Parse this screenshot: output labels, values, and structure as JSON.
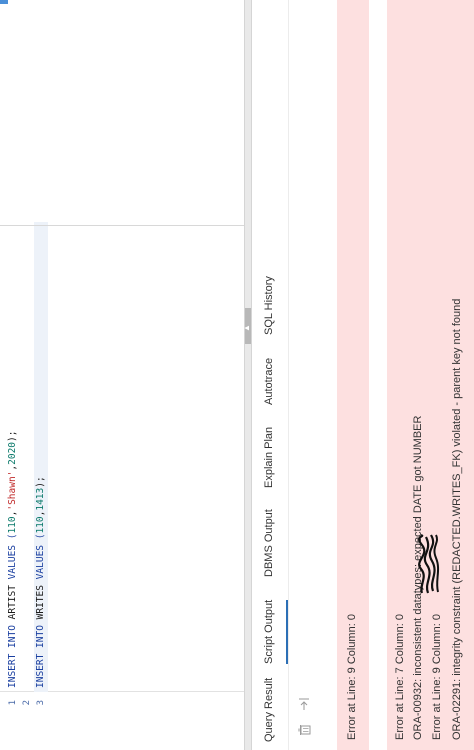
{
  "editor": {
    "lines": [
      {
        "number": "1",
        "tokens": [
          {
            "t": "INSERT INTO ",
            "c": "kw"
          },
          {
            "t": "ARTIST ",
            "c": ""
          },
          {
            "t": "VALUES (",
            "c": "kw"
          },
          {
            "t": "110",
            "c": "num"
          },
          {
            "t": ",",
            "c": ""
          },
          {
            "t": "'Shawn'",
            "c": "str"
          },
          {
            "t": ",",
            "c": ""
          },
          {
            "t": "2020",
            "c": "num"
          },
          {
            "t": ");",
            "c": ""
          }
        ]
      },
      {
        "number": "2",
        "tokens": []
      },
      {
        "number": "3",
        "tokens": [
          {
            "t": "INSERT INTO ",
            "c": "kw"
          },
          {
            "t": "WRITES ",
            "c": ""
          },
          {
            "t": "VALUES (",
            "c": "kw"
          },
          {
            "t": "110",
            "c": "num"
          },
          {
            "t": ",",
            "c": ""
          },
          {
            "t": "1413",
            "c": "num"
          },
          {
            "t": ");",
            "c": ""
          }
        ]
      }
    ]
  },
  "tabs": {
    "query_result": "Query Result",
    "script_output": "Script Output",
    "dbms_output": "DBMS Output",
    "explain_plan": "Explain Plan",
    "autotrace": "Autotrace",
    "sql_history": "SQL History",
    "active": "script_output"
  },
  "toolbar": {
    "icons": [
      "trash-icon",
      "export-icon"
    ]
  },
  "errors": {
    "e1_location": "Error at Line: 9 Column: 0",
    "e2_message": "ORA-00932: inconsistent datatypes: expected DATE got NUMBER",
    "e2_location": "Error at Line: 7 Column: 0",
    "e3_message": "ORA-02291: integrity constraint (REDACTED.WRITES_FK) violated - parent key not found",
    "e3_location": "Error at Line: 9 Column: 0"
  },
  "colors": {
    "error_background": "#fde0e0",
    "active_tab_underline": "#2c6fb5",
    "keyword": "#1a3fa0",
    "number": "#0b7a6b",
    "string": "#c02a2a"
  }
}
